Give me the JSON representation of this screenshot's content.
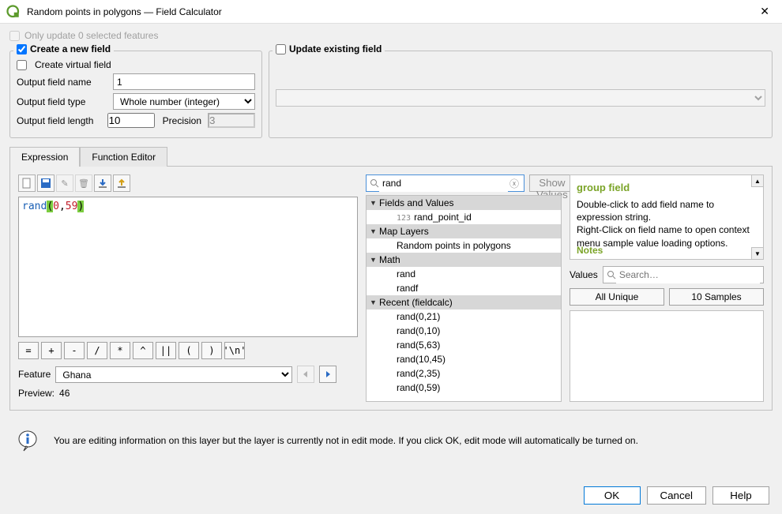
{
  "window": {
    "title": "Random points in polygons — Field Calculator"
  },
  "only_update": {
    "label": "Only update 0 selected features"
  },
  "create_block": {
    "header": "Create a new field",
    "virtual_label": "Create virtual field",
    "name_label": "Output field name",
    "name_value": "1",
    "type_label": "Output field type",
    "type_value": "Whole number (integer)",
    "length_label": "Output field length",
    "length_value": "10",
    "precision_label": "Precision",
    "precision_value": "3"
  },
  "update_block": {
    "header": "Update existing field"
  },
  "tabs": {
    "expression": "Expression",
    "function_editor": "Function Editor"
  },
  "expression": {
    "code_func": "rand",
    "code_open": "(",
    "code_arg1": "0",
    "code_comma": ",",
    "code_arg2": "59",
    "code_close": ")"
  },
  "operators": [
    "=",
    "+",
    "-",
    "/",
    "*",
    "^",
    "||",
    "(",
    ")",
    "'\\n'"
  ],
  "feature": {
    "label": "Feature",
    "value": "Ghana"
  },
  "preview": {
    "label": "Preview:",
    "value": "46"
  },
  "search": {
    "value": "rand",
    "show_values": "Show Values"
  },
  "tree": {
    "g1": "Fields and Values",
    "g1_items": [
      {
        "icon": "123",
        "label": "rand_point_id"
      }
    ],
    "g2": "Map Layers",
    "g2_items": [
      "Random points in polygons"
    ],
    "g3": "Math",
    "g3_items": [
      "rand",
      "randf"
    ],
    "g4": "Recent (fieldcalc)",
    "g4_items": [
      "rand(0,21)",
      "rand(0,10)",
      "rand(5,63)",
      "rand(10,45)",
      "rand(2,35)",
      "rand(0,59)"
    ]
  },
  "help": {
    "title": "group field",
    "text1": "Double-click to add field name to expression string.",
    "text2": "Right-Click on field name to open context menu sample value loading options.",
    "notes": "Notes"
  },
  "values_panel": {
    "label": "Values",
    "search_placeholder": "Search…",
    "all_unique": "All Unique",
    "samples": "10 Samples"
  },
  "info": {
    "text": "You are editing information on this layer but the layer is currently not in edit mode. If you click OK, edit mode will automatically be turned on."
  },
  "buttons": {
    "ok": "OK",
    "cancel": "Cancel",
    "help": "Help"
  }
}
